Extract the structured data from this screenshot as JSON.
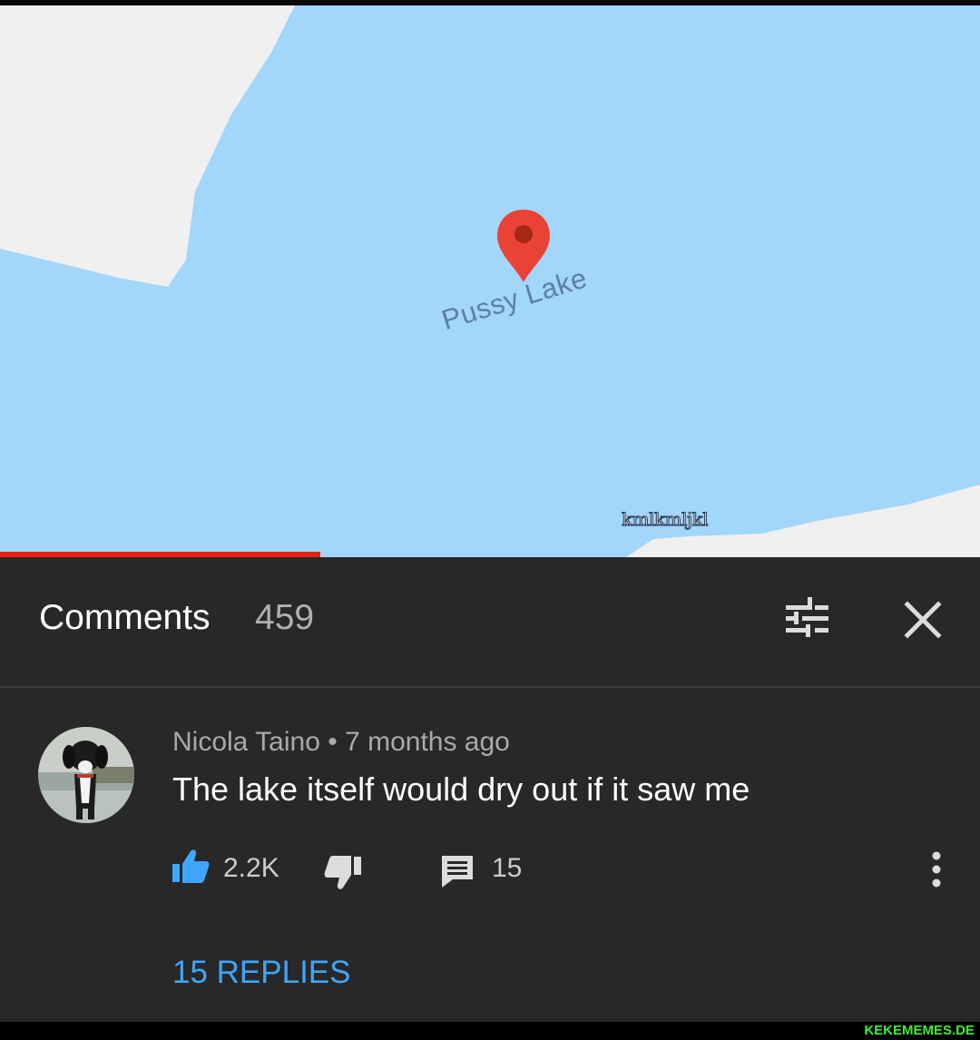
{
  "video": {
    "map_label": "Pussy Lake",
    "watermark": "kmlkmljkl",
    "progress_fraction": 0.327,
    "colors": {
      "water": "#a2d6fb",
      "land": "#f0f0f0",
      "pin": "#ea4335",
      "progress": "#e62117"
    }
  },
  "comments_header": {
    "title": "Comments",
    "count": "459",
    "filter_icon": "sort-filter-icon",
    "close_icon": "close-icon"
  },
  "comment": {
    "author": "Nicola Taino",
    "separator": " • ",
    "time": "7 months ago",
    "text": "The lake itself would dry out if it saw me",
    "like_count": "2.2K",
    "reply_count": "15",
    "replies_link": "15 REPLIES",
    "avatar_icon": "dog-avatar",
    "colors": {
      "link": "#3ea6ff",
      "like": "#3ea6ff"
    }
  },
  "footer": {
    "site": "KEKEMEMES.DE"
  }
}
